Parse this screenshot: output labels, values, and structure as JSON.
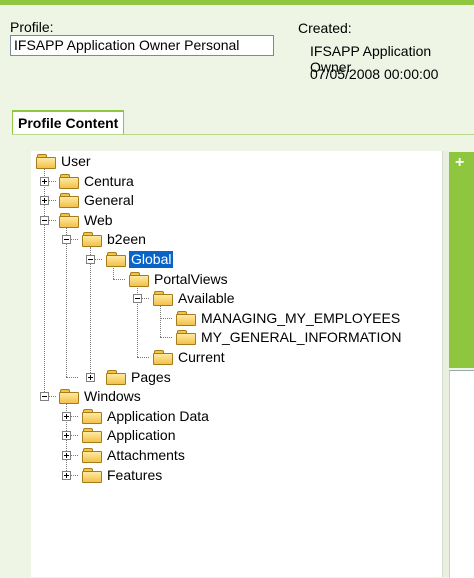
{
  "header": {
    "profile_label": "Profile:",
    "profile_value": "IFSAPP Application Owner Personal",
    "created_label": "Created:",
    "created_by": "IFSAPP Application Owner",
    "created_date": "07/05/2008 00:00:00"
  },
  "tabs": {
    "profile_content": "Profile Content"
  },
  "side_panel": {
    "add_label": "+"
  },
  "tree": {
    "user": "User",
    "centura": "Centura",
    "general": "General",
    "web": "Web",
    "b2een": "b2een",
    "global": "Global",
    "portalviews": "PortalViews",
    "available": "Available",
    "managing": "MANAGING_MY_EMPLOYEES",
    "mygeneral": "MY_GENERAL_INFORMATION",
    "current": "Current",
    "pages": "Pages",
    "windows": "Windows",
    "appdata": "Application Data",
    "application": "Application",
    "attachments": "Attachments",
    "features": "Features"
  },
  "colors": {
    "accent": "#8ec63f",
    "selection": "#0a64c8"
  }
}
